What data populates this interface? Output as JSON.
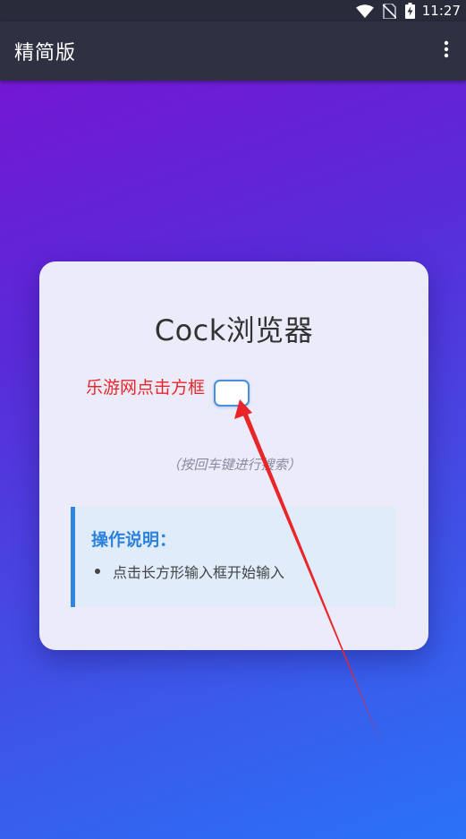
{
  "status_bar": {
    "time": "11:27",
    "icons": [
      "wifi-icon",
      "no-sim-icon",
      "battery-charging-icon"
    ]
  },
  "app_bar": {
    "title": "精简版",
    "menu_icon": "more-vert-icon"
  },
  "card": {
    "title": "Cock浏览器",
    "annotation": "乐游网点击方框",
    "search_hint": "（按回车键进行搜索）",
    "help": {
      "title": "操作说明：",
      "items": [
        "点击长方形输入框开始输入"
      ]
    }
  },
  "colors": {
    "gradient_start": "#7a12d2",
    "gradient_end": "#2a72f8",
    "app_bar": "#2d3142",
    "card_bg": "#ecebfa",
    "annotation": "#e8262a",
    "help_accent": "#2f86de"
  }
}
